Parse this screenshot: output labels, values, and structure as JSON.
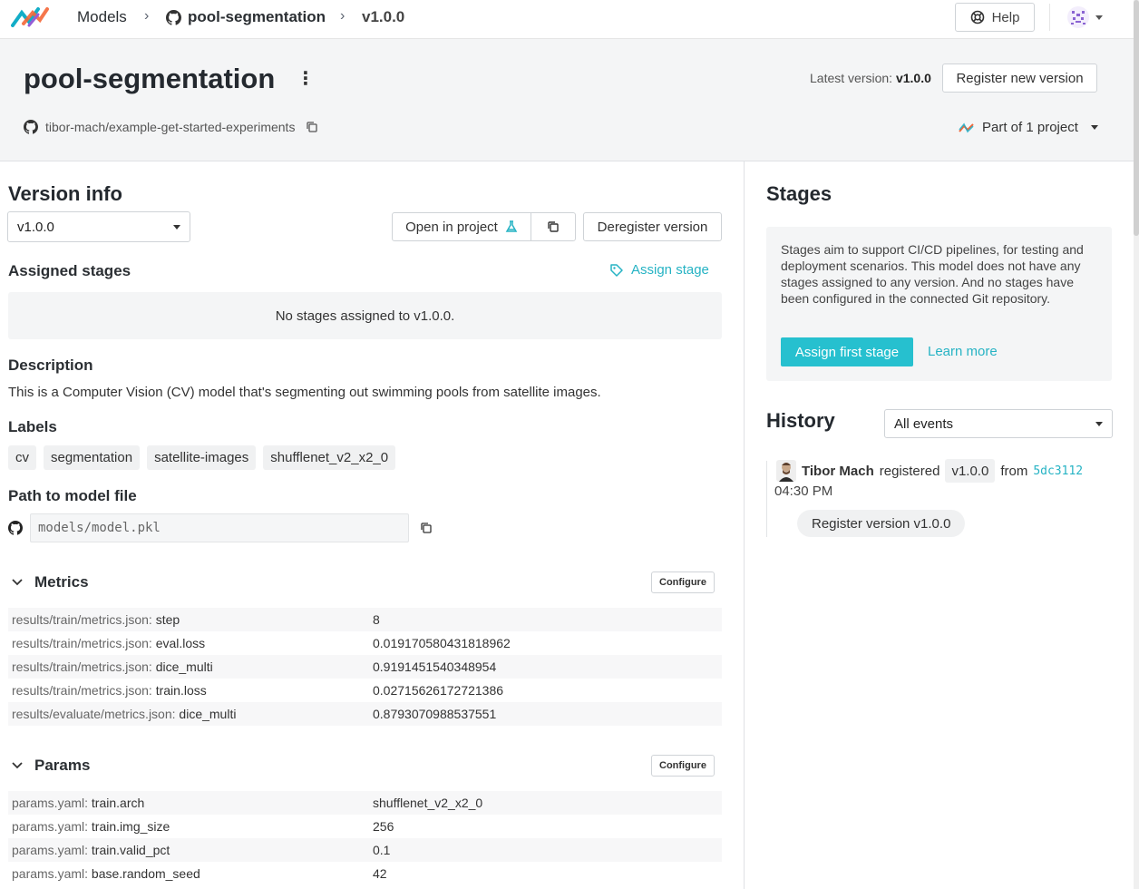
{
  "nav": {
    "models": "Models",
    "repo": "pool-segmentation",
    "version": "v1.0.0",
    "help": "Help"
  },
  "header": {
    "title": "pool-segmentation",
    "latest_label": "Latest version:",
    "latest_value": "v1.0.0",
    "register_btn": "Register new version",
    "repo_path": "tibor-mach/example-get-started-experiments",
    "part_of": "Part of 1 project"
  },
  "version_info": {
    "title": "Version info",
    "selected_version": "v1.0.0",
    "open_in_project": "Open in project",
    "deregister": "Deregister version",
    "assigned_stages": "Assigned stages",
    "assign_stage": "Assign stage",
    "no_stages": "No stages assigned to v1.0.0.",
    "description_title": "Description",
    "description": "This is a Computer Vision (CV) model that's segmenting out swimming pools from satellite images.",
    "labels_title": "Labels",
    "labels": [
      "cv",
      "segmentation",
      "satellite-images",
      "shufflenet_v2_x2_0"
    ],
    "path_title": "Path to model file",
    "path": "models/model.pkl"
  },
  "metrics": {
    "title": "Metrics",
    "configure": "Configure",
    "rows": [
      {
        "src": "results/train/metrics.json:",
        "key": " step",
        "value": "8"
      },
      {
        "src": "results/train/metrics.json:",
        "key": " eval.loss",
        "value": "0.019170580431818962"
      },
      {
        "src": "results/train/metrics.json:",
        "key": " dice_multi",
        "value": "0.9191451540348954"
      },
      {
        "src": "results/train/metrics.json:",
        "key": " train.loss",
        "value": "0.02715626172721386"
      },
      {
        "src": "results/evaluate/metrics.json:",
        "key": " dice_multi",
        "value": "0.8793070988537551"
      }
    ]
  },
  "params": {
    "title": "Params",
    "configure": "Configure",
    "rows": [
      {
        "src": "params.yaml:",
        "key": " train.arch",
        "value": "shufflenet_v2_x2_0"
      },
      {
        "src": "params.yaml:",
        "key": " train.img_size",
        "value": "256"
      },
      {
        "src": "params.yaml:",
        "key": " train.valid_pct",
        "value": "0.1"
      },
      {
        "src": "params.yaml:",
        "key": " base.random_seed",
        "value": "42"
      }
    ]
  },
  "stages": {
    "title": "Stages",
    "text": "Stages aim to support CI/CD pipelines, for testing and deployment scenarios. This model does not have any stages assigned to any version. And no stages have been configured in the connected Git repository.",
    "assign_first": "Assign first stage",
    "learn_more": "Learn more"
  },
  "history": {
    "title": "History",
    "filter": "All events",
    "event": {
      "user": "Tibor Mach",
      "action": "registered",
      "version": "v1.0.0",
      "from": "from",
      "commit": "5dc3112",
      "time": "04:30 PM",
      "label": "Register version v1.0.0"
    }
  },
  "colors": {
    "accent": "#26c0cf",
    "link": "#26b3c4"
  }
}
